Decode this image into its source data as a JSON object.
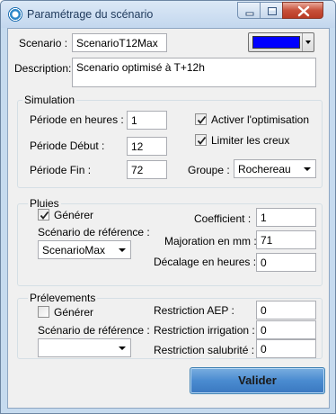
{
  "window": {
    "title": "Paramétrage du scénario"
  },
  "scenario": {
    "label": "Scenario :",
    "value": "ScenarioT12Max",
    "color": "#0000ff"
  },
  "description": {
    "label": "Description:",
    "value": "Scenario optimisé à T+12h"
  },
  "simulation": {
    "title": "Simulation",
    "periode_heures_label": "Période en heures :",
    "periode_heures_value": "1",
    "periode_debut_label": "Période Début  :",
    "periode_debut_value": "12",
    "periode_fin_label": "Période Fin  :",
    "periode_fin_value": "72",
    "activer_optimisation_label": "Activer l'optimisation",
    "activer_optimisation_checked": true,
    "limiter_creux_label": "Limiter les creux",
    "limiter_creux_checked": true,
    "groupe_label": "Groupe :",
    "groupe_value": "Rochereau"
  },
  "pluies": {
    "title": "Pluies",
    "generer_label": "Générer",
    "generer_checked": true,
    "scenario_ref_label": "Scénario de référence :",
    "scenario_ref_value": "ScenarioMax",
    "coefficient_label": "Coefficient :",
    "coefficient_value": "1",
    "majoration_label": "Majoration en mm :",
    "majoration_value": "71",
    "decalage_label": "Décalage en heures :",
    "decalage_value": "0"
  },
  "prelevements": {
    "title": "Prélevements",
    "generer_label": "Générer",
    "generer_checked": false,
    "scenario_ref_label": "Scénario de référence :",
    "scenario_ref_value": "",
    "restriction_aep_label": "Restriction AEP :",
    "restriction_aep_value": "0",
    "restriction_irrigation_label": "Restriction irrigation :",
    "restriction_irrigation_value": "0",
    "restriction_salubrite_label": "Restriction salubrité :",
    "restriction_salubrite_value": "0"
  },
  "actions": {
    "valider_label": "Valider"
  }
}
